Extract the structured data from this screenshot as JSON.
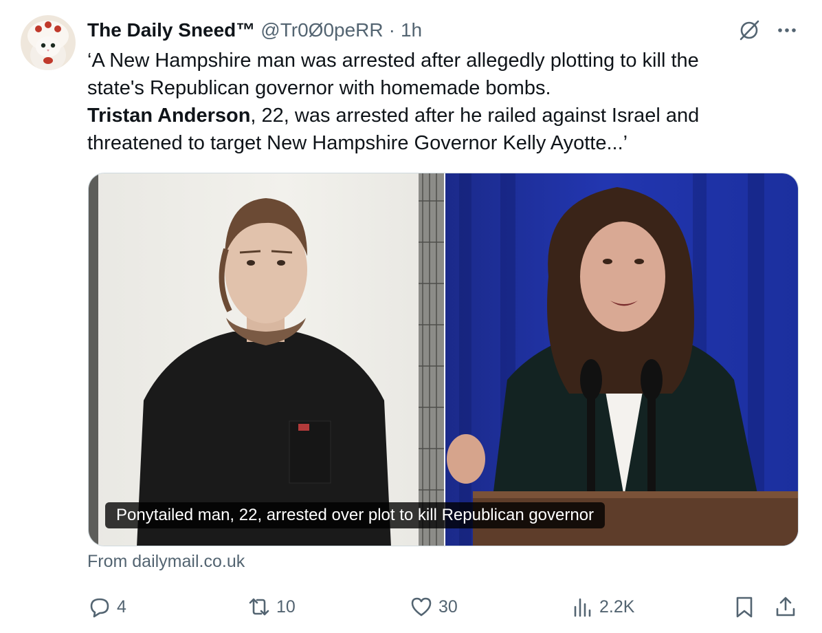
{
  "tweet": {
    "display_name": "The Daily Sneed™",
    "handle": "@Tr0Ø0peRR",
    "separator": "·",
    "time": "1h",
    "text_lines": [
      "‘A New Hampshire man was arrested after allegedly plotting to kill the",
      "state's Republican governor with homemade bombs."
    ],
    "bold_name": "Tristan Anderson",
    "text_line3_rest": ", 22, was arrested after he railed against Israel and",
    "text_line4": "threatened to target New Hampshire Governor Kelly Ayotte...’"
  },
  "card": {
    "caption": "Ponytailed man, 22, arrested over plot to kill Republican governor",
    "source": "From dailymail.co.uk"
  },
  "actions": {
    "replies": "4",
    "reposts": "10",
    "likes": "30",
    "views": "2.2K"
  },
  "icons": {
    "grok": "grok-icon",
    "more": "more-icon",
    "reply": "reply-icon",
    "repost": "repost-icon",
    "like": "heart-icon",
    "views": "views-icon",
    "bookmark": "bookmark-icon",
    "share": "share-icon"
  },
  "colors": {
    "text_primary": "#0f1419",
    "text_secondary": "#536471",
    "card_border": "#cfd9de"
  }
}
